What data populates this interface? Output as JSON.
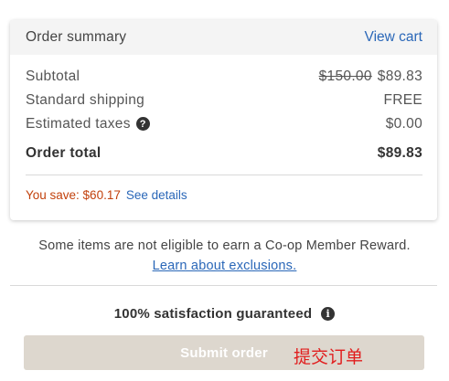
{
  "summary": {
    "title": "Order summary",
    "view_cart": "View cart",
    "subtotal_label": "Subtotal",
    "subtotal_original": "$150.00",
    "subtotal_value": "$89.83",
    "shipping_label": "Standard shipping",
    "shipping_value": "FREE",
    "taxes_label": "Estimated taxes",
    "taxes_help": "?",
    "taxes_value": "$0.00",
    "total_label": "Order total",
    "total_value": "$89.83",
    "savings_text": "You save: $60.17",
    "see_details": "See details"
  },
  "notice": {
    "text": "Some items are not eligible to earn a Co-op Member Reward.",
    "link": "Learn about exclusions."
  },
  "guarantee": {
    "text": "100% satisfaction guaranteed",
    "info": "i"
  },
  "submit": {
    "label": "Submit order",
    "annotation": "提交订单"
  },
  "colors": {
    "link": "#2a67b8",
    "savings": "#c2410c",
    "button_bg": "#ddd7ce",
    "annotation": "#e11d1d"
  }
}
